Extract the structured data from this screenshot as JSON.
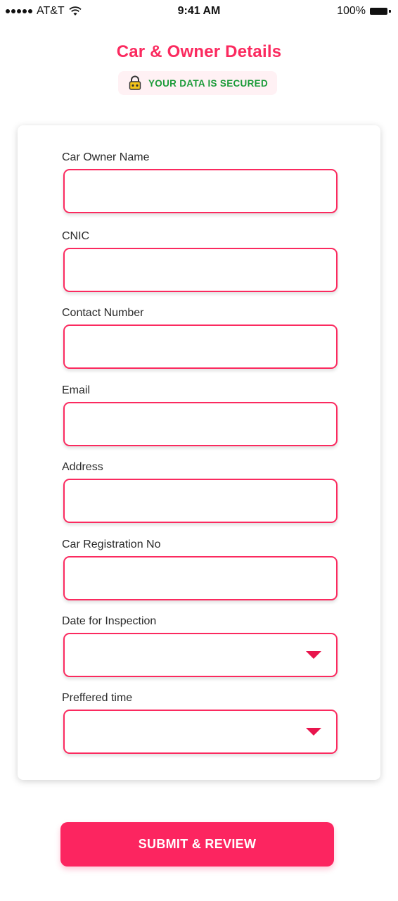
{
  "status_bar": {
    "carrier": "AT&T",
    "time": "9:41 AM",
    "battery": "100%"
  },
  "header": {
    "title": "Car & Owner Details",
    "secure_text": "YOUR DATA IS SECURED"
  },
  "form": {
    "fields": [
      {
        "label": "Car Owner Name",
        "value": ""
      },
      {
        "label": "CNIC",
        "value": ""
      },
      {
        "label": "Contact Number",
        "value": ""
      },
      {
        "label": "Email",
        "value": ""
      },
      {
        "label": "Address",
        "value": ""
      },
      {
        "label": "Car Registration No",
        "value": ""
      },
      {
        "label": "Date for Inspection",
        "value": ""
      },
      {
        "label": "Preffered time",
        "value": ""
      }
    ]
  },
  "submit": {
    "label": "SUBMIT & REVIEW"
  },
  "colors": {
    "accent": "#fb2a5f",
    "secure_green": "#1d9b3a",
    "badge_bg": "#fff1f4"
  }
}
